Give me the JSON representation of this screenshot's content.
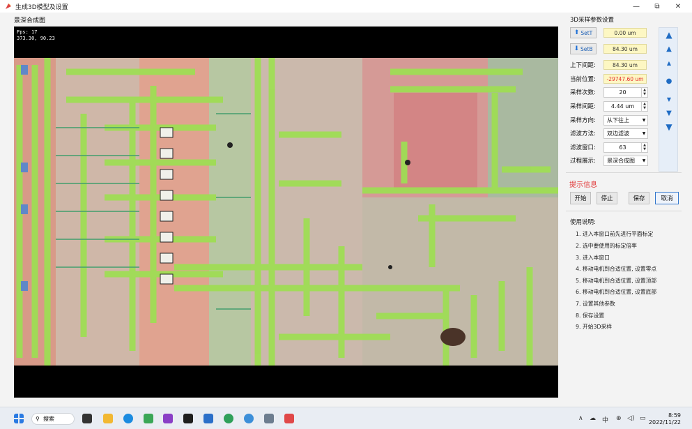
{
  "window": {
    "title": "生成3D模型及设置",
    "controls": {
      "minimize": "—",
      "maximize": "⧉",
      "close": "✕"
    }
  },
  "preview": {
    "label": "景深合成图",
    "fps": "Fps: 17",
    "coords": "373.30, 90.23"
  },
  "panel": {
    "title": "3D采样参数设置",
    "set_top": {
      "label": "SetT",
      "value": "0.00 um"
    },
    "set_bottom": {
      "label": "SetB",
      "value": "84.30 um"
    },
    "distance": {
      "label": "上下间距:",
      "value": "84.30 um"
    },
    "position": {
      "label": "当前位置:",
      "value": "-29747.60 um"
    },
    "samples": {
      "label": "采样次数:",
      "value": "20"
    },
    "spacing": {
      "label": "采样间距:",
      "value": "4.44 um"
    },
    "direction": {
      "label": "采样方向:",
      "value": "从下往上"
    },
    "filter": {
      "label": "滤波方法:",
      "value": "双边滤波"
    },
    "window": {
      "label": "滤波窗口:",
      "value": "63"
    },
    "display": {
      "label": "过程展示:",
      "value": "景深合成图"
    }
  },
  "hint": {
    "label": "提示信息"
  },
  "buttons": {
    "start": "开始",
    "stop": "停止",
    "save": "保存",
    "cancel": "取消"
  },
  "usage": {
    "title": "使用说明:",
    "items": [
      "1. 进入本窗口前先进行平面标定",
      "2. 选中要使用的标定倍率",
      "3. 进入本窗口",
      "4. 移动电机到合适位置, 设置零点",
      "5. 移动电机到合适位置, 设置顶部",
      "6. 移动电机到合适位置, 设置底部",
      "7. 设置其他参数",
      "8. 保存设置",
      "9. 开始3D采样"
    ]
  },
  "taskbar": {
    "search": "搜索",
    "time": "8:59",
    "date": "2022/11/22"
  }
}
